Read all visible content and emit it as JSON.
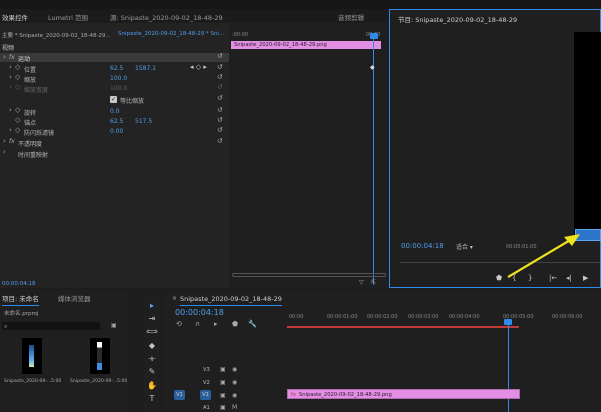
{
  "top_tabs": {
    "effect_controls": "效果控件",
    "lumetri": "Lumetri 范围",
    "source": "源: Snipaste_2020-09-02_18-48-29.png: Snipaste_2020-09-02_18-48-29.png: 00:00:00:00",
    "audio_mixer": "音频剪辑"
  },
  "effect_controls": {
    "master_label": "主要 * Snipaste_2020-09-02_18-48-29...",
    "sequence_label": "Snipaste_2020-09-02_18-48-29 * Sni...",
    "video_header": "视频",
    "motion": "运动",
    "properties": [
      {
        "name": "位置",
        "v1": "62.5",
        "v2": "1587.1"
      },
      {
        "name": "缩放",
        "v1": "100.0",
        "v2": ""
      },
      {
        "name": "缩放宽度",
        "v1": "100.0",
        "v2": ""
      },
      {
        "name": "等比缩放",
        "v1": "",
        "v2": ""
      },
      {
        "name": "旋转",
        "v1": "0.0",
        "v2": ""
      },
      {
        "name": "锚点",
        "v1": "62.5",
        "v2": "517.5"
      },
      {
        "name": "防闪烁滤镜",
        "v1": "0.00",
        "v2": ""
      }
    ],
    "opacity": "不透明度",
    "time_remap": "时间重映射",
    "timecode": "00:00:04:18",
    "mini_ruler": {
      "start": ":00:00",
      "end": "00:00"
    },
    "mini_clip": "Snipaste_2020-09-02_18-48-29.png"
  },
  "program": {
    "tab": "节目: Snipaste_2020-09-02_18-48-29",
    "timecode": "00:00:04:18",
    "fit": "适合",
    "tick": "00:00:01:00"
  },
  "project": {
    "tab_project": "项目: 未命名",
    "tab_media": "媒体浏览器",
    "file": "未命名.prproj",
    "item1_name": "Snipaste_2020-09-...",
    "item1_dur": "5:00",
    "item2_name": "Snipaste_2020-09-...",
    "item2_dur": "5:00"
  },
  "timeline": {
    "tab": "Snipaste_2020-09-02_18-48-29",
    "timecode": "00:00:04:18",
    "ruler": [
      "00:00",
      "00:00:01:00",
      "00:00:02:00",
      "00:00:03:00",
      "00:00:04:00",
      "00:00:05:00",
      "00:00:06:00"
    ],
    "tracks": [
      "V3",
      "V2",
      "V1",
      "A1"
    ],
    "track_src": "V1",
    "clip": "Snipaste_2020-09-02_18-48-29.png"
  },
  "colors": {
    "accent": "#2d8ceb",
    "clip": "#e18ee3",
    "arrow": "#f0e21c"
  }
}
